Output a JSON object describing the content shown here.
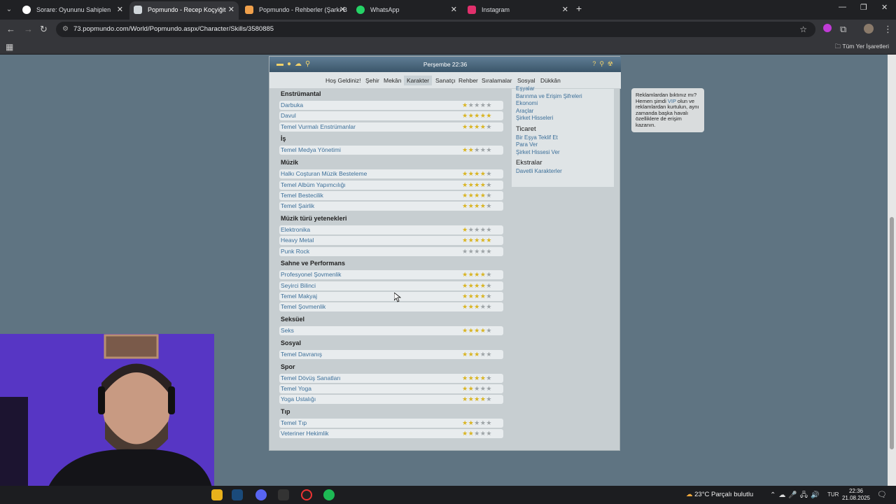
{
  "browser": {
    "tabs": [
      {
        "title": "Sorare: Oyununu Sahiplen",
        "color": "#ffffff"
      },
      {
        "title": "Popmundo - Recep Koçyiğit",
        "color": "#e6e6e6"
      },
      {
        "title": "Popmundo - Rehberler (Şarkı B",
        "color": "#f0a04b"
      },
      {
        "title": "WhatsApp",
        "color": "#25d366"
      },
      {
        "title": "Instagram",
        "color": "#e1306c"
      }
    ],
    "url": "73.popmundo.com/World/Popmundo.aspx/Character/Skills/3580885",
    "bookmarks_all": "Tüm Yer İşaretleri"
  },
  "game": {
    "time": "Perşembe 22:36",
    "menu": [
      "Hoş Geldiniz!",
      "Şehir",
      "Mekân",
      "Karakter",
      "Sanatçı",
      "Rehber",
      "Sıralamalar",
      "Sosyal",
      "Dükkân"
    ],
    "active_menu": "Karakter"
  },
  "skills": [
    {
      "category": "Enstrümantal",
      "items": [
        {
          "name": "Darbuka",
          "stars": 1
        },
        {
          "name": "Davul",
          "stars": 5
        },
        {
          "name": "Temel Vurmalı Enstrümanlar",
          "stars": 4
        }
      ]
    },
    {
      "category": "İş",
      "items": [
        {
          "name": "Temel Medya Yönetimi",
          "stars": 2
        }
      ]
    },
    {
      "category": "Müzik",
      "items": [
        {
          "name": "Halkı Coşturan Müzik Besteleme",
          "stars": 4
        },
        {
          "name": "Temel Albüm Yapımcılığı",
          "stars": 4
        },
        {
          "name": "Temel Bestecilik",
          "stars": 4
        },
        {
          "name": "Temel Şairlik",
          "stars": 4
        }
      ]
    },
    {
      "category": "Müzik türü yetenekleri",
      "items": [
        {
          "name": "Elektronika",
          "stars": 1
        },
        {
          "name": "Heavy Metal",
          "stars": 5
        },
        {
          "name": "Punk Rock",
          "stars": 0
        }
      ]
    },
    {
      "category": "Sahne ve Performans",
      "items": [
        {
          "name": "Profesyonel Şovmenlik",
          "stars": 4
        },
        {
          "name": "Seyirci Bilinci",
          "stars": 4
        },
        {
          "name": "Temel Makyaj",
          "stars": 4
        },
        {
          "name": "Temel Şovmenlik",
          "stars": 3
        }
      ]
    },
    {
      "category": "Seksüel",
      "items": [
        {
          "name": "Seks",
          "stars": 4
        }
      ]
    },
    {
      "category": "Sosyal",
      "items": [
        {
          "name": "Temel Davranış",
          "stars": 3
        }
      ]
    },
    {
      "category": "Spor",
      "items": [
        {
          "name": "Temel Dövüş Sanatları",
          "stars": 4
        },
        {
          "name": "Temel Yoga",
          "stars": 2
        },
        {
          "name": "Yoga Ustalığı",
          "stars": 4
        }
      ]
    },
    {
      "category": "Tıp",
      "items": [
        {
          "name": "Temel Tıp",
          "stars": 2
        },
        {
          "name": "Veteriner Hekimlik",
          "stars": 2
        }
      ]
    }
  ],
  "sidepanel": {
    "links_top": [
      "Eşyalar",
      "Barınma ve Erişim Şifreleri",
      "Ekonomi",
      "Araçlar",
      "Şirket Hisseleri"
    ],
    "heading_trade": "Ticaret",
    "links_trade": [
      "Bir Eşya Teklif Et",
      "Para Ver",
      "Şirket Hissesi Ver"
    ],
    "heading_extras": "Ekstralar",
    "links_extras": [
      "Davetli Karakterler"
    ]
  },
  "ad": {
    "text_before": "Reklamlardan bıktınız mı? Hemen şimdi",
    "vip": "VIP",
    "text_after": "olun ve reklamlardan kurtulun, aynı zamanda başka havalı özelliklere de erişim kazanın."
  },
  "taskbar": {
    "weather": "23°C  Parçalı bulutlu",
    "lang": "TUR",
    "time": "22:36",
    "date": "21.08.2025"
  }
}
